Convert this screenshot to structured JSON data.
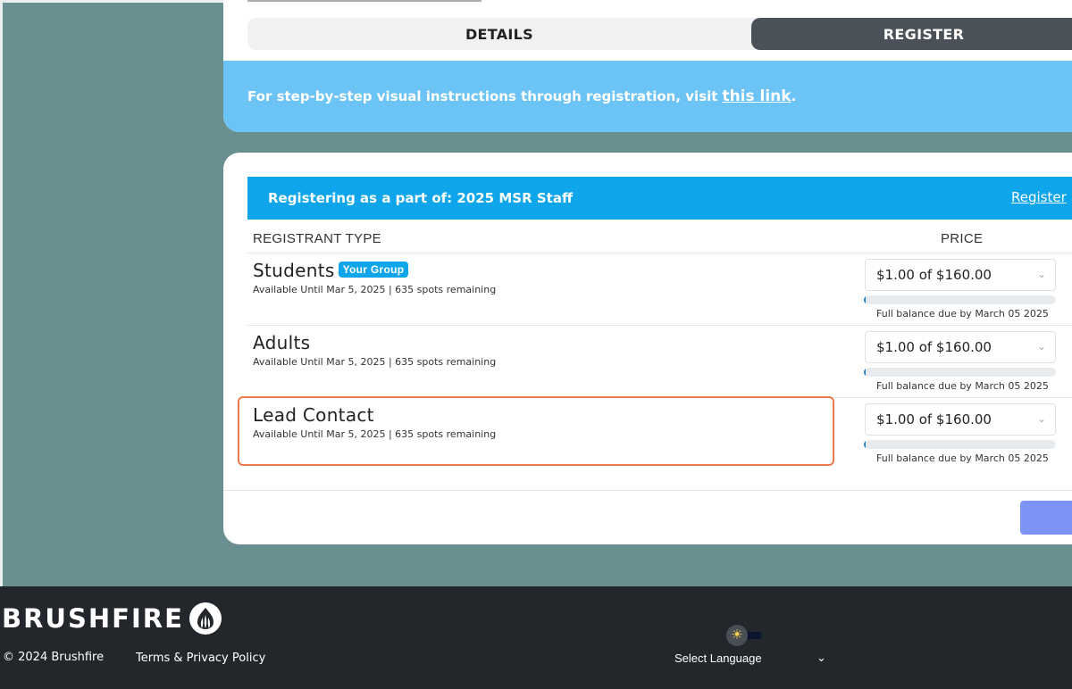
{
  "tabs": {
    "details": "DETAILS",
    "register": "REGISTER"
  },
  "instructions": {
    "text": "For step-by-step visual instructions through registration, visit",
    "link": "this link",
    "suffix": "."
  },
  "group": {
    "text": "Registering as a part of: 2025 MSR Staff",
    "link": "Register"
  },
  "columns": {
    "type": "REGISTRANT TYPE",
    "price": "PRICE"
  },
  "rows": [
    {
      "name": "Students",
      "badge": "Your Group",
      "availability": "Available Until Mar 5, 2025 | 635 spots remaining",
      "price": "$1.00 of $160.00",
      "due": "Full balance due by March 05 2025",
      "progress": 0.01
    },
    {
      "name": "Adults",
      "availability": "Available Until Mar 5, 2025 | 635 spots remaining",
      "price": "$1.00 of $160.00",
      "due": "Full balance due by March 05 2025",
      "progress": 0.01
    },
    {
      "name": "Lead Contact",
      "availability": "Available Until Mar 5, 2025 | 635 spots remaining",
      "price": "$1.00 of $160.00",
      "due": "Full balance due by March 05 2025",
      "progress": 0.01
    }
  ],
  "footer": {
    "logo": "BRUSHFIRE",
    "copyright": "© 2024 Brushfire",
    "terms": "Terms & Privacy Policy",
    "language": "Select Language"
  },
  "colors": {
    "accent": "#0ea5ea",
    "instructionBar": "#6cc3f6",
    "highlight": "#ee7a4d",
    "footer": "#23272b"
  }
}
